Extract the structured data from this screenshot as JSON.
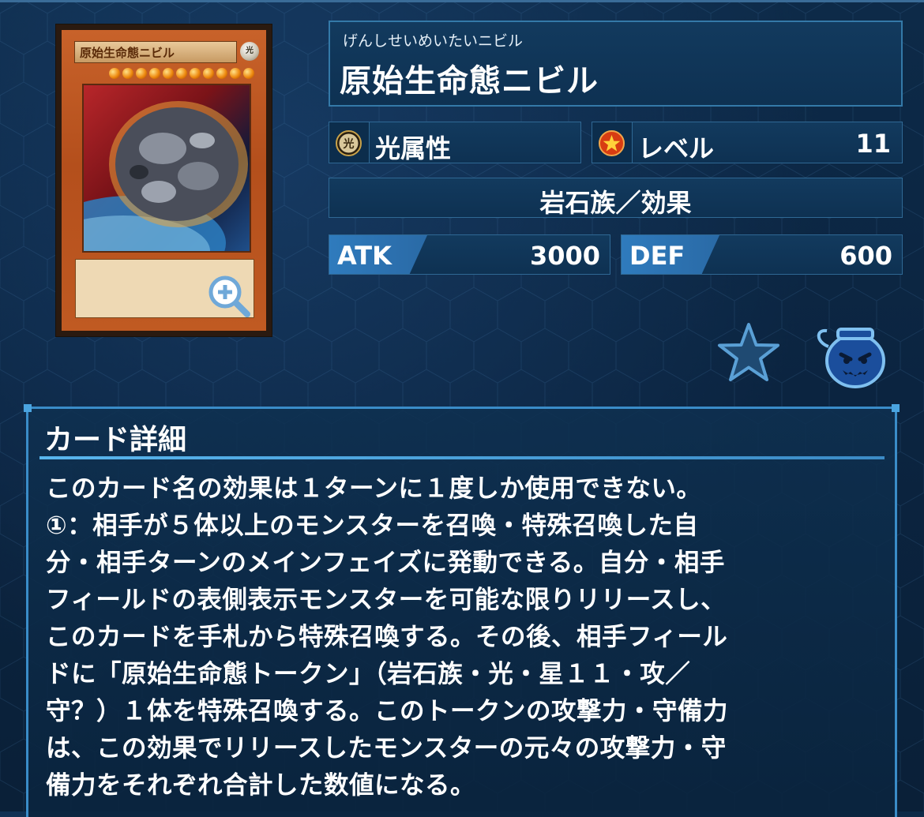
{
  "card_image": {
    "name_on_card": "原始生命態ニビル",
    "attribute_glyph": "光",
    "level_stars": 11,
    "zoom_icon": "magnifier-plus-icon"
  },
  "header": {
    "ruby": "げんしせいめいたいニビル",
    "name": "原始生命態ニビル"
  },
  "attribute": {
    "icon": "light-attribute-icon",
    "label": "光属性"
  },
  "level": {
    "icon": "level-star-icon",
    "label": "レベル",
    "value": "11"
  },
  "type_line": "岩石族／効果",
  "stats": {
    "atk_label": "ATK",
    "atk_value": "3000",
    "def_label": "DEF",
    "def_value": "600"
  },
  "actions": {
    "favorite_icon": "star-icon",
    "pot_icon": "pot-of-greed-icon"
  },
  "detail": {
    "title": "カード詳細",
    "text": "このカード名の効果は１ターンに１度しか使用できない。\n①：相手が５体以上のモンスターを召喚・特殊召喚した自\n分・相手ターンのメインフェイズに発動できる。自分・相手\nフィールドの表側表示モンスターを可能な限りリリースし、\nこのカードを手札から特殊召喚する。その後、相手フィール\nドに「原始生命態トークン」（岩石族・光・星１１・攻／\n守？）１体を特殊召喚する。このトークンの攻撃力・守備力\nは、この効果でリリースしたモンスターの元々の攻撃力・守\n備力をそれぞれ合計した数値になる。"
  },
  "colors": {
    "background": "#0c2644",
    "panel": "#123a5e",
    "panel_border": "#2f6894",
    "accent": "#3a8cc8",
    "stat_label": "#2f7bbd"
  }
}
